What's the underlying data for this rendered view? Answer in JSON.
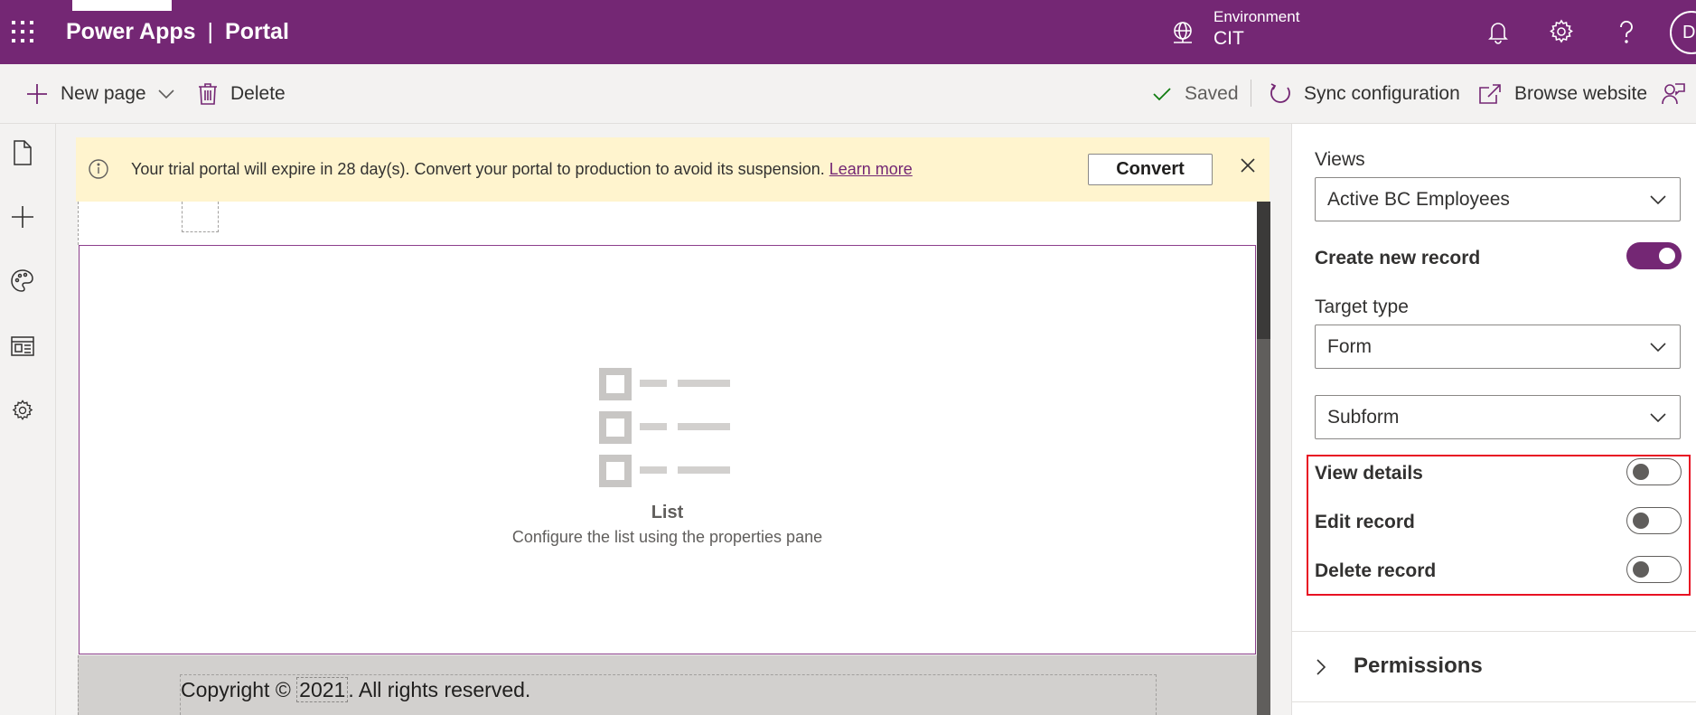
{
  "header": {
    "app_name": "Power Apps",
    "separator": "|",
    "section": "Portal",
    "environment_label": "Environment",
    "environment_value": "CIT",
    "avatar_initials": "DI",
    "brand_color": "#742774"
  },
  "toolbar": {
    "new_page": "New page",
    "delete": "Delete",
    "status": "Saved",
    "sync": "Sync configuration",
    "browse": "Browse website"
  },
  "rail": {
    "icons": [
      "pages-icon",
      "add-icon",
      "theme-icon",
      "templates-icon",
      "settings-icon"
    ]
  },
  "banner": {
    "message": "Your trial portal will expire in 28 day(s). Convert your portal to production to avoid its suspension.",
    "link": "Learn more",
    "button": "Convert"
  },
  "canvas": {
    "list_title": "List",
    "list_subtitle": "Configure the list using the properties pane",
    "copyright_prefix": "Copyright ©",
    "copyright_year": "2021",
    "copyright_suffix": ". All rights reserved."
  },
  "properties": {
    "views_label": "Views",
    "views_value": "Active BC Employees",
    "create_new_record": {
      "label": "Create new record",
      "enabled": true
    },
    "target_type_label": "Target type",
    "target_type_value": "Form",
    "form_value": "Subform",
    "view_details": {
      "label": "View details",
      "enabled": false
    },
    "edit_record": {
      "label": "Edit record",
      "enabled": false
    },
    "delete_record": {
      "label": "Delete record",
      "enabled": false
    },
    "permissions_label": "Permissions"
  }
}
